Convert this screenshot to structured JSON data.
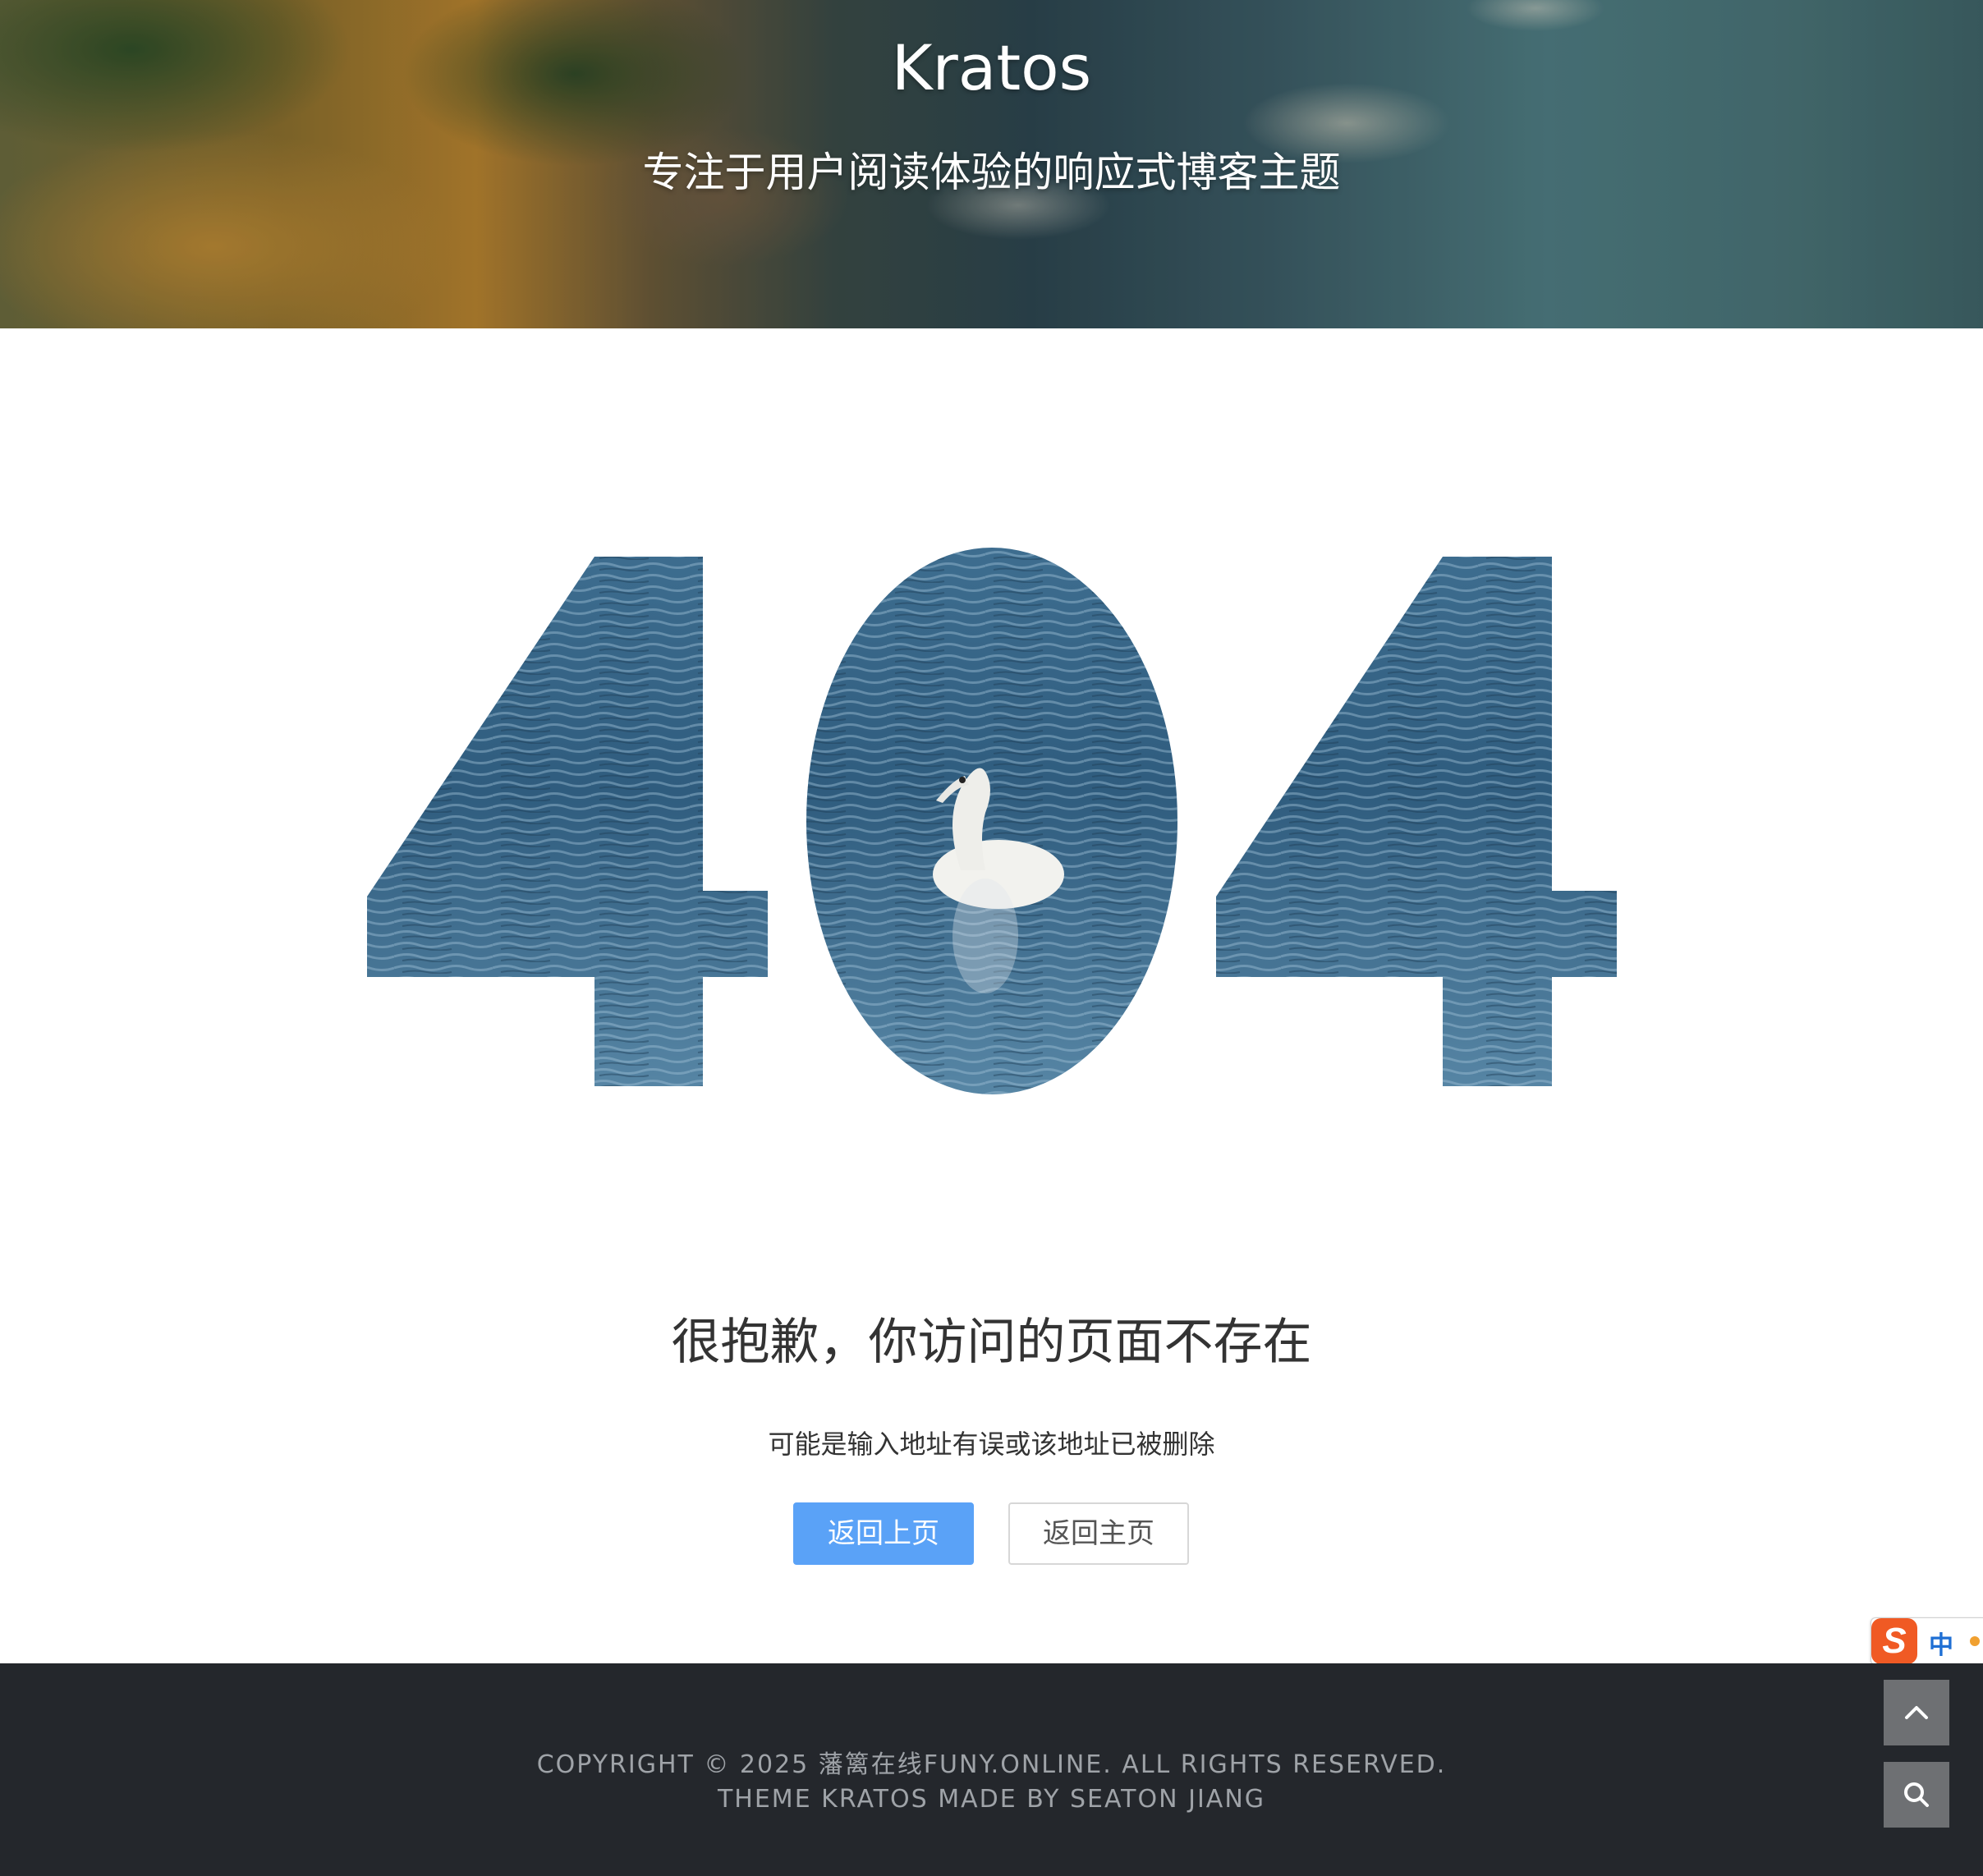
{
  "header": {
    "site_title": "Kratos",
    "site_subtitle": "专注于用户阅读体验的响应式博客主题"
  },
  "error_art": {
    "text": "404"
  },
  "message": {
    "title": "很抱歉，你访问的页面不存在",
    "subtitle": "可能是输入地址有误或该地址已被删除"
  },
  "actions": {
    "back_label": "返回上页",
    "home_label": "返回主页"
  },
  "ime": {
    "logo_letter": "S",
    "mode": "中"
  },
  "footer": {
    "copyright": "COPYRIGHT © 2025 藩篱在线FUNY.ONLINE. ALL RIGHTS RESERVED.",
    "theme_credit": "THEME KRATOS MADE BY SEATON JIANG"
  },
  "floating": {
    "to_top_icon": "chevron-up-icon",
    "search_icon": "search-icon"
  },
  "colors": {
    "primary_button": "#5aa2f7",
    "footer_bg": "#24272c",
    "floating_button_bg": "#6e7073"
  }
}
